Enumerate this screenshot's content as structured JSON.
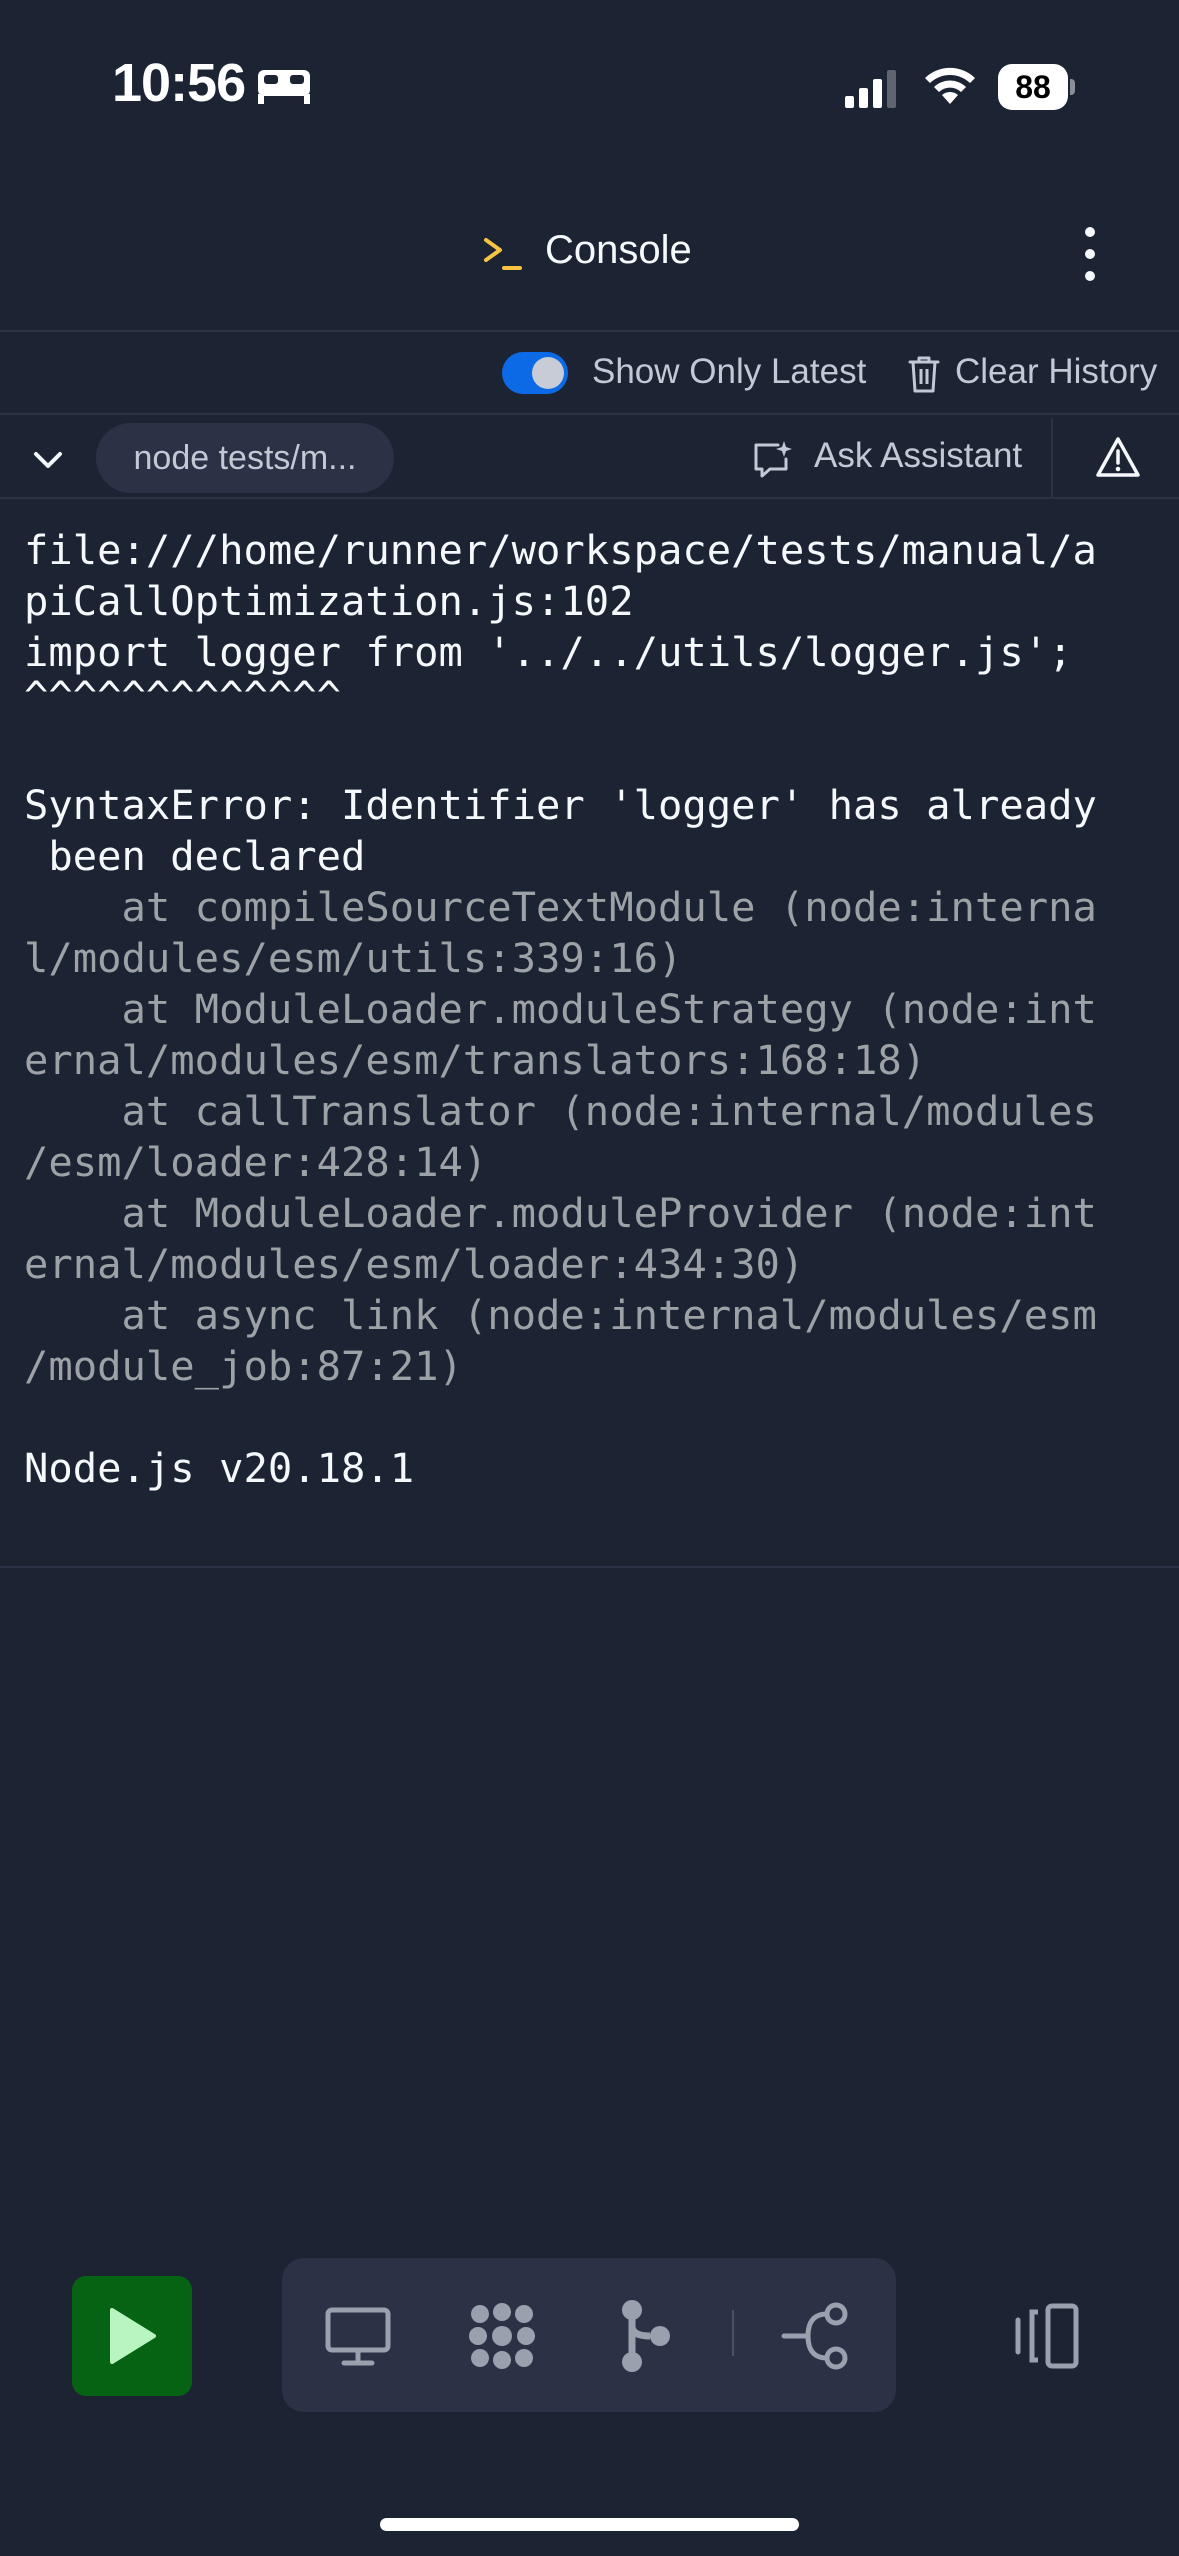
{
  "status_bar": {
    "time": "10:56",
    "battery": "88",
    "icons": [
      "bed-icon",
      "cellular-signal-icon",
      "wifi-icon",
      "battery-icon"
    ]
  },
  "header": {
    "title": "Console",
    "title_icon": "console-prompt-icon",
    "menu_icon": "kebab-menu-icon"
  },
  "toolbar": {
    "toggle_on": true,
    "show_only_latest_label": "Show Only Latest",
    "clear_history_label": "Clear History",
    "command_label": "node tests/m...",
    "ask_assistant_label": "Ask Assistant"
  },
  "output": {
    "line1": "file:///home/runner/workspace/tests/manual/a",
    "line2": "piCallOptimization.js:102",
    "line3": "import logger from '../../utils/logger.js';",
    "line4": "^^^^^^^^^^^^^",
    "line5": "SyntaxError: Identifier 'logger' has already",
    "line6": " been declared",
    "stack1a": "    at compileSourceTextModule (node:interna",
    "stack1b": "l/modules/esm/utils:339:16)",
    "stack2a": "    at ModuleLoader.moduleStrategy (node:int",
    "stack2b": "ernal/modules/esm/translators:168:18)",
    "stack3a": "    at callTranslator (node:internal/modules",
    "stack3b": "/esm/loader:428:14)",
    "stack4a": "    at ModuleLoader.moduleProvider (node:int",
    "stack4b": "ernal/modules/esm/loader:434:30)",
    "stack5a": "    at async link (node:internal/modules/esm",
    "stack5b": "/module_job:87:21)",
    "version": "Node.js v20.18.1"
  },
  "bottom_bar": {
    "run_color": "#066314",
    "icons": [
      "play-icon",
      "monitor-icon",
      "extensions-icon",
      "git-icon",
      "workflow-icon",
      "panels-icon"
    ]
  },
  "colors": {
    "background": "#1c2333",
    "surface": "#2b3245",
    "accent": "#0d6ae6",
    "text": "#f5f9fc",
    "muted": "#c2c8d4",
    "stack": "#9da2a6",
    "prompt": "#f6c343"
  }
}
